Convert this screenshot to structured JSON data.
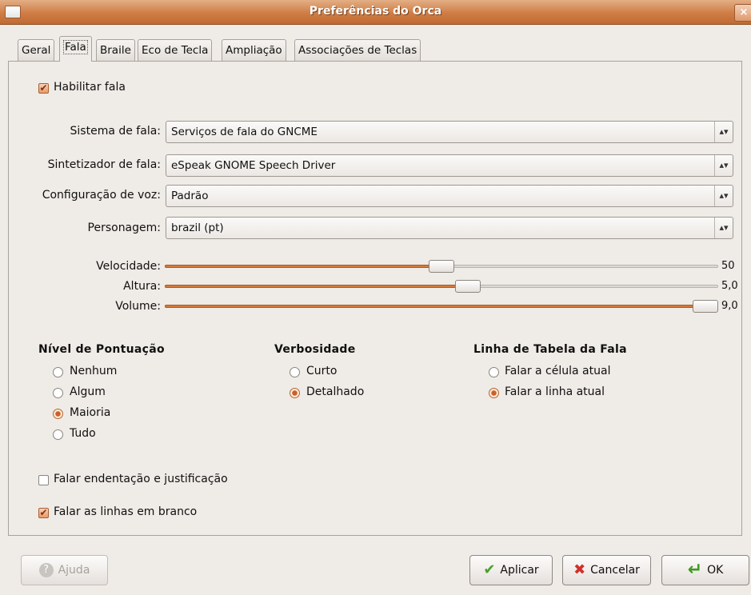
{
  "window": {
    "title": "Preferências do Orca",
    "close_glyph": "×"
  },
  "tabs": [
    {
      "label": "Geral"
    },
    {
      "label": "Fala",
      "active": true
    },
    {
      "label": "Braile"
    },
    {
      "label": "Eco de Tecla"
    },
    {
      "label": "Ampliação"
    },
    {
      "label": "Associações de Teclas"
    }
  ],
  "enable_speech": {
    "label": "Habilitar fala",
    "checked": true
  },
  "combos": {
    "system": {
      "label": "Sistema de fala:",
      "value": "Serviços de fala do GNCME"
    },
    "synth": {
      "label": "Sintetizador de fala:",
      "value": "eSpeak GNOME Speech Driver"
    },
    "voice": {
      "label": "Configuração de voz:",
      "value": "Padrão"
    },
    "person": {
      "label": "Personagem:",
      "value": "brazil (pt)"
    },
    "arrow_glyph": "▴▾"
  },
  "sliders": {
    "rate": {
      "label": "Velocidade:",
      "value": "50",
      "fraction": 0.5
    },
    "pitch": {
      "label": "Altura:",
      "value": "5,0",
      "fraction": 0.55
    },
    "volume": {
      "label": "Volume:",
      "value": "9,0",
      "fraction": 1.0
    }
  },
  "punctuation": {
    "title": "Nível de Pontuação",
    "options": [
      {
        "label": "Nenhum",
        "selected": false
      },
      {
        "label": "Algum",
        "selected": false
      },
      {
        "label": "Maioria",
        "selected": true
      },
      {
        "label": "Tudo",
        "selected": false
      }
    ]
  },
  "verbosity": {
    "title": "Verbosidade",
    "options": [
      {
        "label": "Curto",
        "selected": false
      },
      {
        "label": "Detalhado",
        "selected": true
      }
    ]
  },
  "table_rows": {
    "title": "Linha de Tabela da Fala",
    "options": [
      {
        "label": "Falar a célula atual",
        "selected": false
      },
      {
        "label": "Falar a linha atual",
        "selected": true
      }
    ]
  },
  "indentation": {
    "label": "Falar endentação e justificação",
    "checked": false
  },
  "blank_lines": {
    "label": "Falar as linhas em branco",
    "checked": true
  },
  "check_glyph": "✔",
  "buttons": {
    "help": {
      "label": "Ajuda",
      "icon": "help-icon",
      "glyph": "?"
    },
    "apply": {
      "label": "Aplicar",
      "icon": "checkmark-icon",
      "glyph": "✔"
    },
    "cancel": {
      "label": "Cancelar",
      "icon": "cancel-icon",
      "glyph": "✖"
    },
    "ok": {
      "label": "OK",
      "icon": "enter-arrow-icon",
      "glyph": "↵"
    }
  },
  "colors": {
    "titlebar": "#cf7d45",
    "accent": "#d47a3b",
    "background": "#efebe7"
  }
}
